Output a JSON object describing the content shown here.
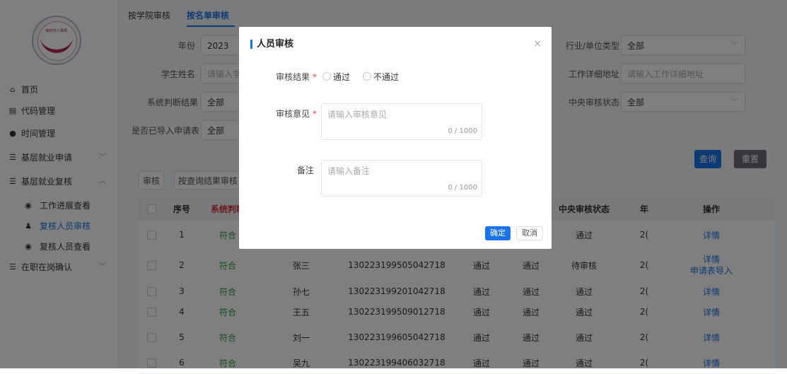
{
  "sidebar": {
    "logo_text": "廊坊市人事局",
    "items": [
      {
        "icon": "home-icon",
        "glyph": "⌂",
        "label": "首页"
      },
      {
        "icon": "code-icon",
        "glyph": "▤",
        "label": "代码管理"
      },
      {
        "icon": "clock-icon",
        "glyph": "●",
        "label": "时间管理"
      },
      {
        "icon": "form-icon",
        "glyph": "☰",
        "label": "基层就业申请"
      },
      {
        "icon": "form-icon",
        "glyph": "☰",
        "label": "基层就业复核"
      }
    ],
    "subitems": [
      {
        "icon": "eye-icon",
        "glyph": "◉",
        "label": "工作进展查看"
      },
      {
        "icon": "user-icon",
        "glyph": "♟",
        "label": "复核人员审核"
      },
      {
        "icon": "eye-icon",
        "glyph": "◉",
        "label": "复核人员查看"
      }
    ],
    "last_item": {
      "icon": "form-icon",
      "glyph": "☰",
      "label": "在职在岗确认"
    }
  },
  "tabs": [
    "按学院审核",
    "按名单审核"
  ],
  "filters": {
    "year_label": "年份",
    "year_value": "2023",
    "name_label": "学生姓名",
    "name_placeholder": "请输入学生",
    "sys_label": "系统判断结果",
    "sys_value": "全部",
    "imported_label": "是否已导入申请表",
    "imported_value": "全部",
    "industry_label": "行业/单位类型",
    "industry_value": "全部",
    "address_label": "工作详细地址",
    "address_placeholder": "请输入工作详细地址",
    "central_label": "中央审核状态",
    "central_value": "全部"
  },
  "buttons": {
    "query": "查询",
    "reset": "重置",
    "audit": "审核",
    "audit_by_query": "按查询结果审核"
  },
  "table": {
    "headers": {
      "index": "序号",
      "system": "系统判断",
      "central": "中央审核状态",
      "year": "年",
      "ops": "操作"
    },
    "rows": [
      {
        "index": "1",
        "system": "符合",
        "name": "",
        "id": "",
        "s1": "",
        "s2": "",
        "central": "通过",
        "year": "2(",
        "ops": "详情",
        "ops2": ""
      },
      {
        "index": "2",
        "system": "符合",
        "name": "张三",
        "id": "130223199505042718",
        "s1": "通过",
        "s2": "通过",
        "central": "待审核",
        "year": "2(",
        "ops": "详情",
        "ops2": "申请表导入"
      },
      {
        "index": "3",
        "system": "符合",
        "name": "孙七",
        "id": "130223199201042718",
        "s1": "通过",
        "s2": "通过",
        "central": "通过",
        "year": "2(",
        "ops": "详情",
        "ops2": ""
      },
      {
        "index": "4",
        "system": "符合",
        "name": "王五",
        "id": "130223199509012718",
        "s1": "通过",
        "s2": "通过",
        "central": "通过",
        "year": "2(",
        "ops": "详情",
        "ops2": ""
      },
      {
        "index": "5",
        "system": "符合",
        "name": "刘一",
        "id": "130223199605042718",
        "s1": "通过",
        "s2": "通过",
        "central": "通过",
        "year": "2(",
        "ops": "详情",
        "ops2": ""
      },
      {
        "index": "6",
        "system": "符合",
        "name": "吴九",
        "id": "130223199406032718",
        "s1": "通过",
        "s2": "通过",
        "central": "通过",
        "year": "2(",
        "ops": "详情",
        "ops2": ""
      }
    ]
  },
  "dialog": {
    "title": "人员审核",
    "close_glyph": "×",
    "result_label": "审核结果",
    "opinion_label": "审核意见",
    "remark_label": "备注",
    "required_mark": "*",
    "options": [
      "通过",
      "不通过"
    ],
    "opinion_placeholder": "请输入审核意见",
    "remark_placeholder": "请输入备注",
    "counter": "0 / 1000",
    "confirm": "确定",
    "cancel": "取消"
  },
  "colors": {
    "accent": "#1a73e8",
    "green": "#2e9e3f",
    "red": "#d9343f"
  }
}
